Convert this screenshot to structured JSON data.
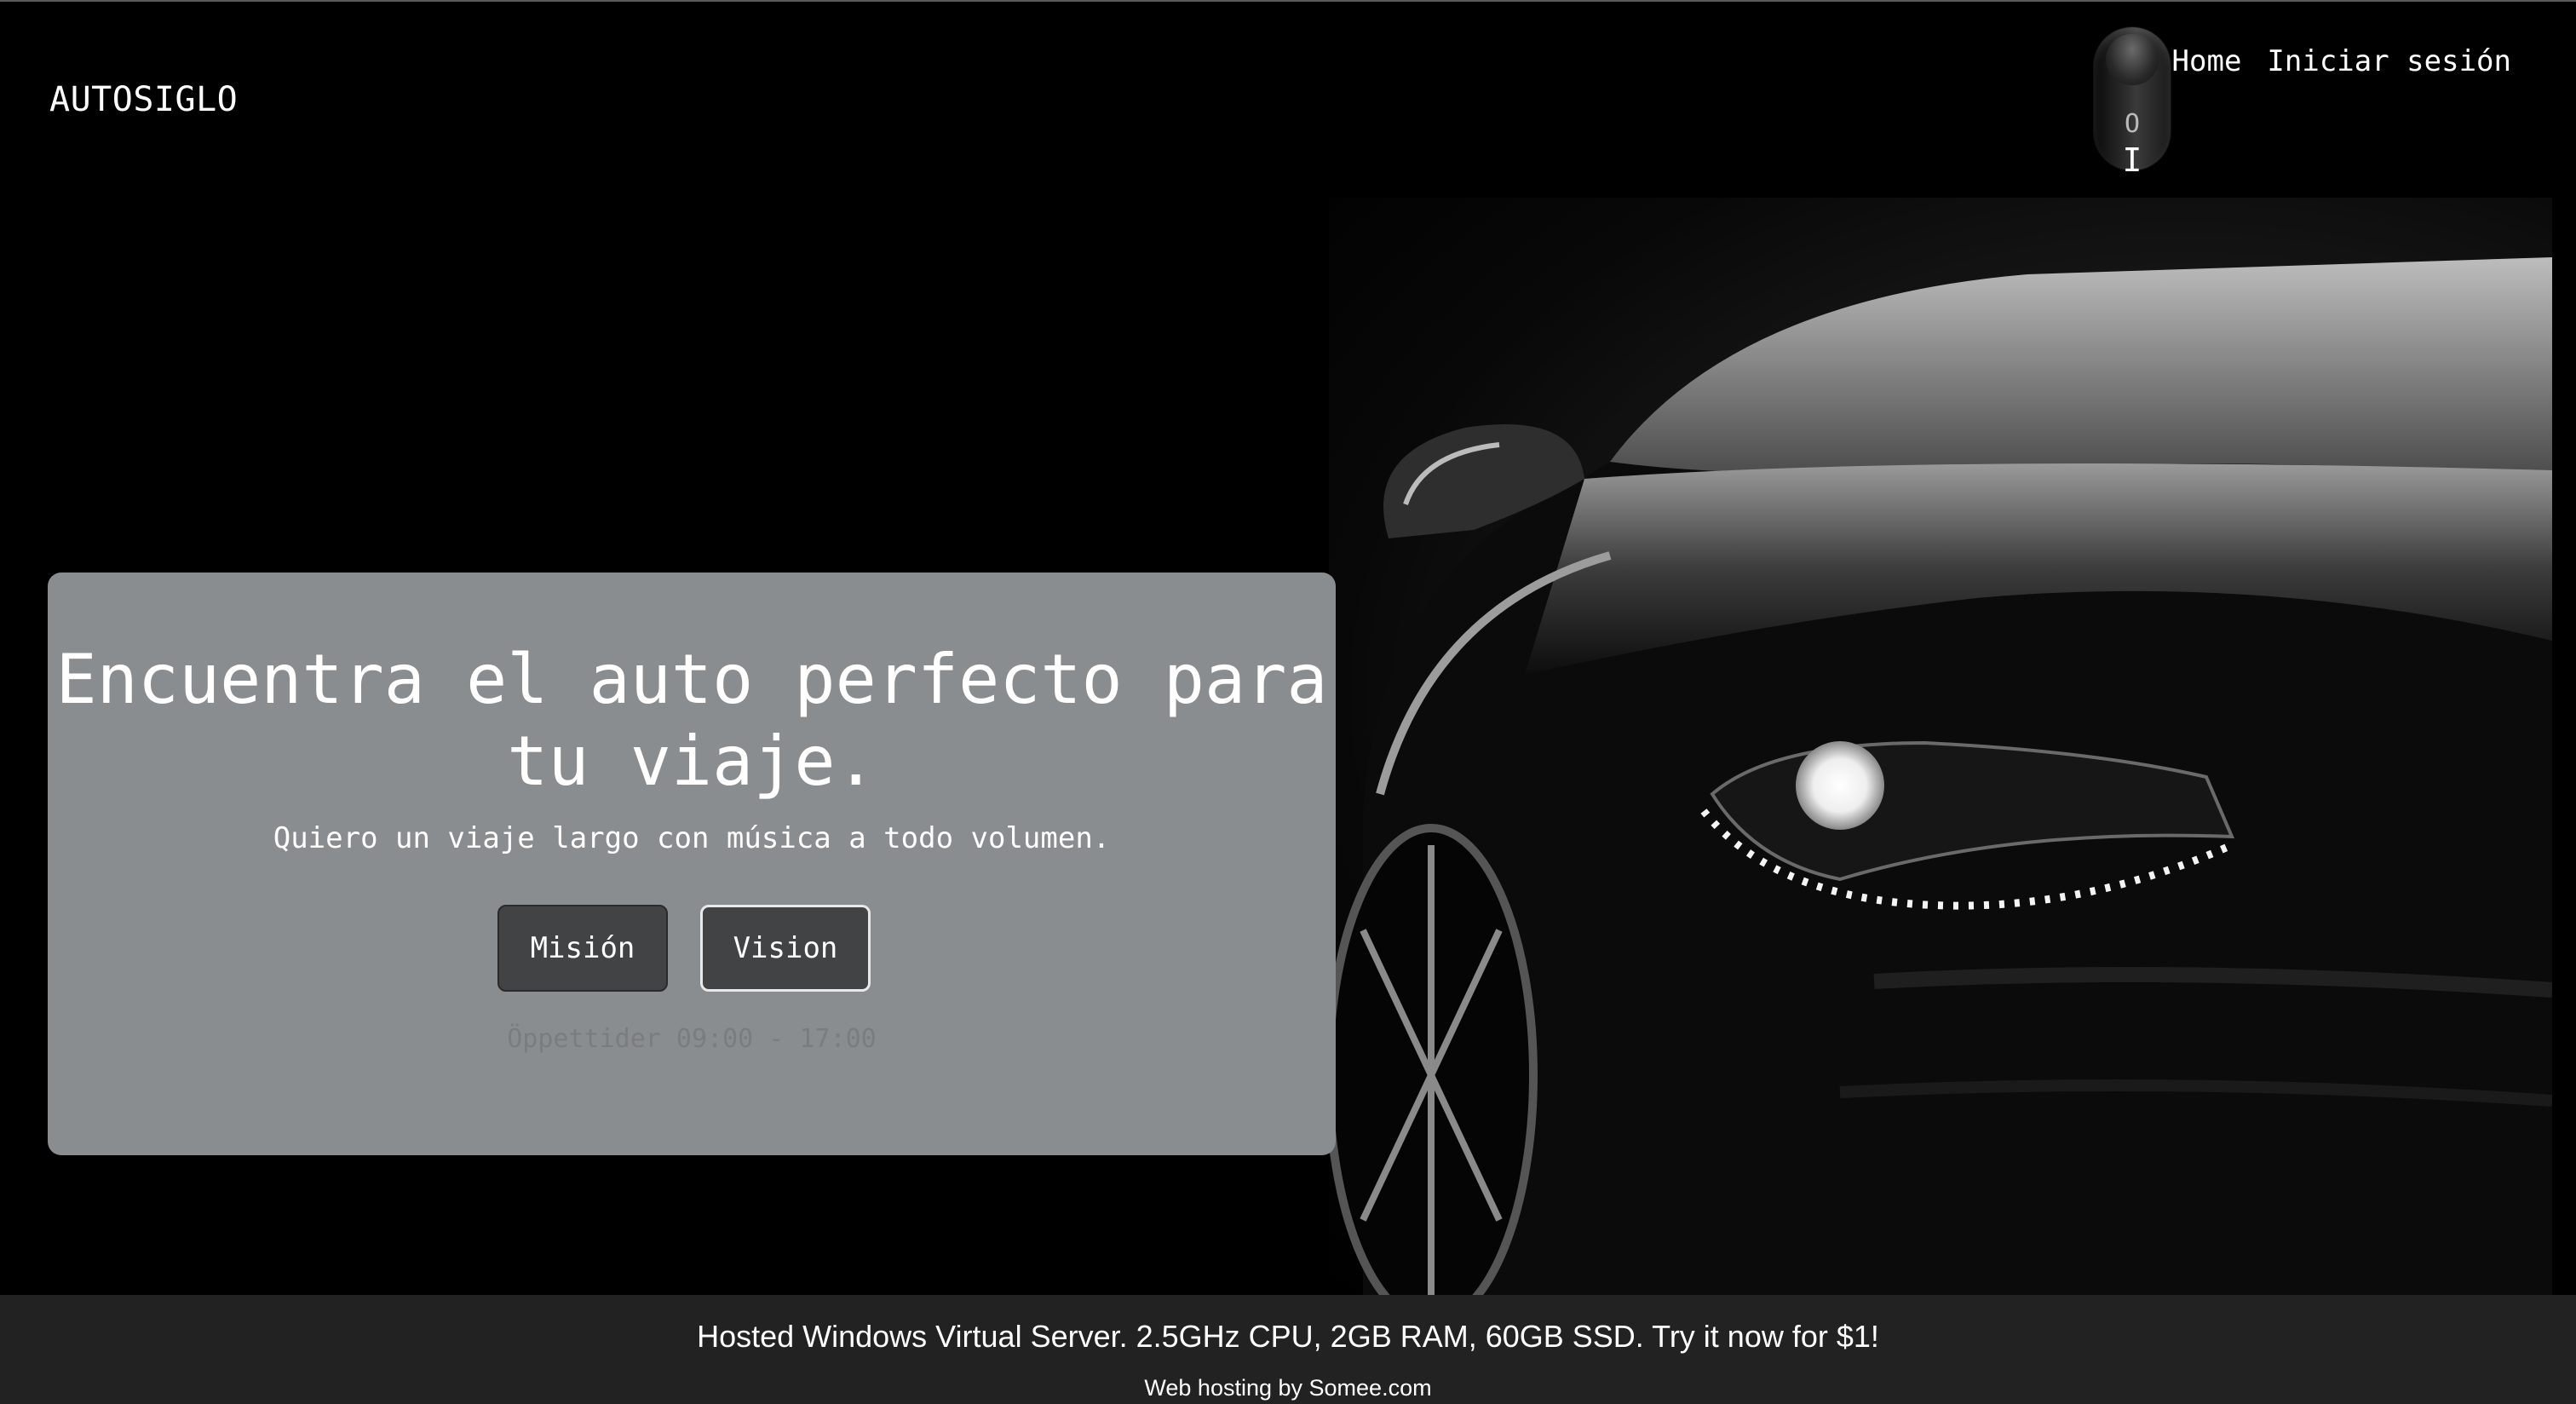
{
  "header": {
    "brand": "AUTOSIGLO",
    "toggle": {
      "off_label": "O",
      "on_label": "I"
    },
    "nav": [
      {
        "label": "Home"
      },
      {
        "label": "Iniciar sesión"
      }
    ]
  },
  "hero": {
    "title": "Encuentra el auto perfecto para tu viaje.",
    "subtitle": "Quiero un viaje largo con música a todo volumen.",
    "buttons": {
      "mision": "Misión",
      "vision": "Vision"
    },
    "hours": "Öppettider 09:00 - 17:00"
  },
  "footer": {
    "ad": "Hosted Windows Virtual Server. 2.5GHz CPU, 2GB RAM, 60GB SSD. Try it now for $1!",
    "hosting": "Web hosting by Somee.com"
  },
  "colors": {
    "background": "#000000",
    "card": "#8a8d8f",
    "button": "#424345",
    "footer": "#222222"
  }
}
